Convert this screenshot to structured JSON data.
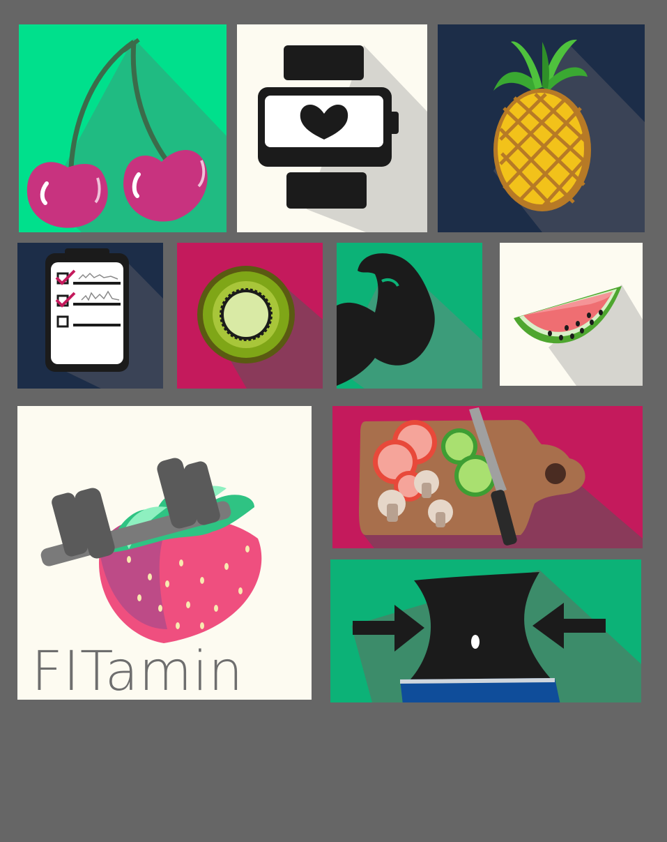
{
  "app": {
    "brand_name": "FITamin"
  },
  "colors": {
    "background": "#666666",
    "mint": "#00e08c",
    "green": "#0cb277",
    "navy": "#1c2d48",
    "magenta": "#c41a5c",
    "cream": "#fdfbf1",
    "black": "#1b1b1b"
  },
  "tiles": [
    {
      "name": "cherries",
      "icon": "cherries-icon",
      "bg": "mint"
    },
    {
      "name": "heart-rate-watch",
      "icon": "smartwatch-heart-icon",
      "bg": "cream"
    },
    {
      "name": "pineapple",
      "icon": "pineapple-icon",
      "bg": "navy"
    },
    {
      "name": "checklist",
      "icon": "checklist-clipboard-icon",
      "bg": "navy"
    },
    {
      "name": "kiwi",
      "icon": "kiwi-slice-icon",
      "bg": "magenta"
    },
    {
      "name": "bicep",
      "icon": "flexed-bicep-icon",
      "bg": "green"
    },
    {
      "name": "watermelon",
      "icon": "watermelon-slice-icon",
      "bg": "cream"
    },
    {
      "name": "fitamin-logo",
      "icon": "strawberry-dumbbell-icon",
      "bg": "cream"
    },
    {
      "name": "cutting-board",
      "icon": "cutting-board-vegetables-icon",
      "bg": "magenta"
    },
    {
      "name": "slim-waist",
      "icon": "slim-waist-icon",
      "bg": "green"
    }
  ]
}
